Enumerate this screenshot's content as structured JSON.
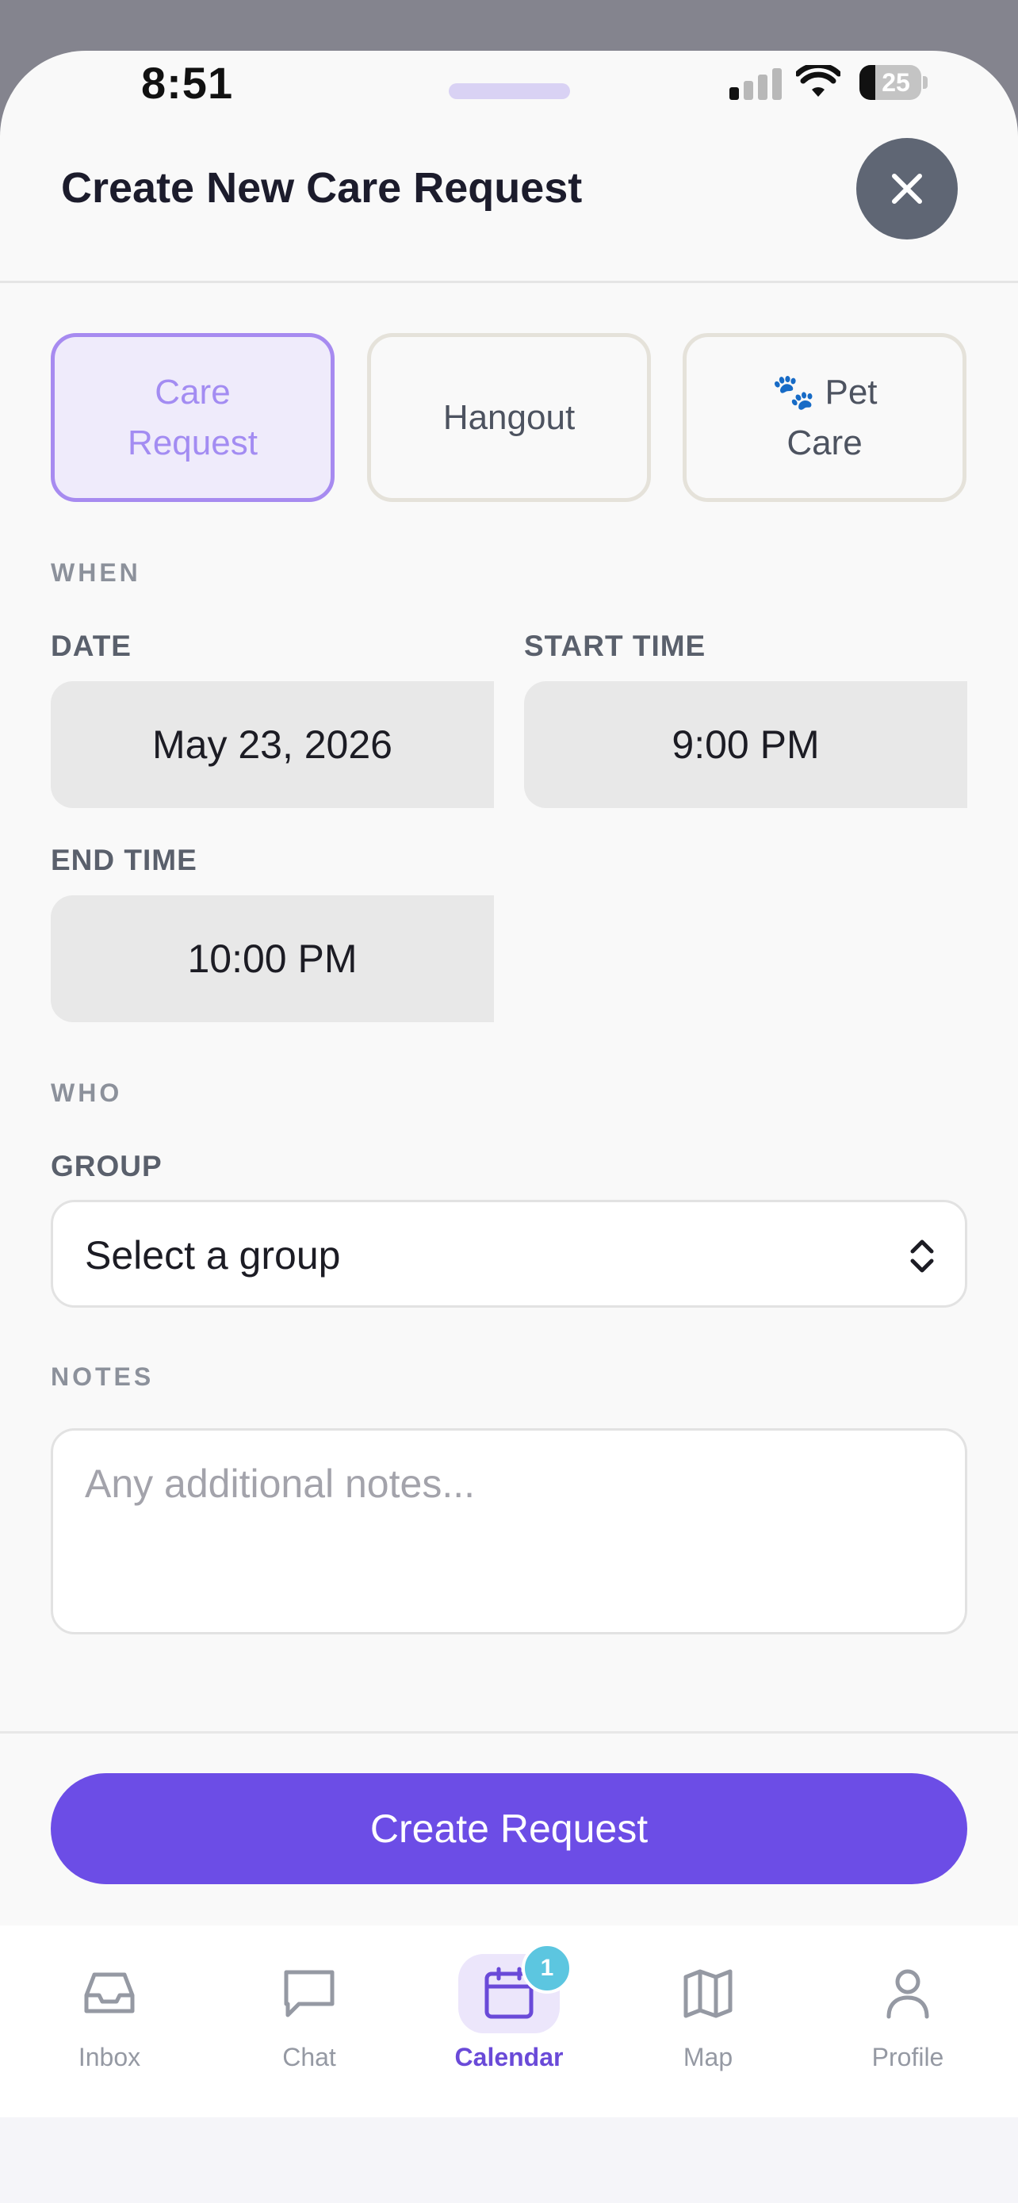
{
  "status": {
    "time": "8:51",
    "battery": "25"
  },
  "header": {
    "title": "Create New Care Request"
  },
  "types": [
    {
      "label": "Care\nRequest",
      "selected": true
    },
    {
      "label": "Hangout",
      "selected": false
    },
    {
      "label": "🐾 Pet\nCare",
      "selected": false
    }
  ],
  "when": {
    "section": "WHEN",
    "date_label": "DATE",
    "date_value": "May 23, 2026",
    "start_label": "START TIME",
    "start_value": "9:00 PM",
    "end_label": "END TIME",
    "end_value": "10:00 PM"
  },
  "who": {
    "section": "WHO",
    "group_label": "GROUP",
    "group_value": "Select a group"
  },
  "notes": {
    "section": "NOTES",
    "placeholder": "Any additional notes..."
  },
  "submit_label": "Create Request",
  "tabbar": {
    "items": [
      {
        "label": "Inbox",
        "icon": "inbox-icon"
      },
      {
        "label": "Chat",
        "icon": "chat-icon"
      },
      {
        "label": "Calendar",
        "icon": "calendar-icon",
        "badge": "1",
        "active": true
      },
      {
        "label": "Map",
        "icon": "map-icon"
      },
      {
        "label": "Profile",
        "icon": "profile-icon"
      }
    ]
  },
  "colors": {
    "accent": "#6c4de6",
    "chip_selected_border": "#a78bf0",
    "badge": "#5cc6e0"
  }
}
